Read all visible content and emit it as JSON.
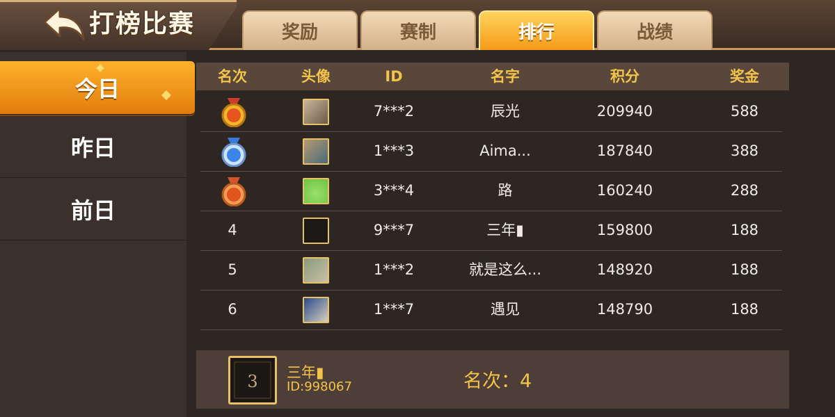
{
  "header": {
    "title": "打榜比赛",
    "tabs": [
      {
        "label": "奖励",
        "active": false
      },
      {
        "label": "赛制",
        "active": false
      },
      {
        "label": "排行",
        "active": true
      },
      {
        "label": "战绩",
        "active": false
      }
    ]
  },
  "sidebar": {
    "items": [
      {
        "label": "今日",
        "active": true
      },
      {
        "label": "昨日",
        "active": false
      },
      {
        "label": "前日",
        "active": false
      }
    ]
  },
  "table": {
    "columns": [
      "名次",
      "头像",
      "ID",
      "名字",
      "积分",
      "奖金"
    ],
    "rows": [
      {
        "rank": "1",
        "medal": "gold-medal-icon",
        "id": "7***2",
        "name": "辰光",
        "score": "209940",
        "bonus": "588"
      },
      {
        "rank": "2",
        "medal": "silver-medal-icon",
        "id": "1***3",
        "name": "Aima...",
        "score": "187840",
        "bonus": "388"
      },
      {
        "rank": "3",
        "medal": "bronze-medal-icon",
        "id": "3***4",
        "name": "路",
        "score": "160240",
        "bonus": "288"
      },
      {
        "rank": "4",
        "medal": "",
        "id": "9***7",
        "name": "三年▮",
        "score": "159800",
        "bonus": "188"
      },
      {
        "rank": "5",
        "medal": "",
        "id": "1***2",
        "name": "就是这么...",
        "score": "148920",
        "bonus": "188"
      },
      {
        "rank": "6",
        "medal": "",
        "id": "1***7",
        "name": "遇见",
        "score": "148790",
        "bonus": "188"
      }
    ]
  },
  "my_rank": {
    "name": "三年▮",
    "id": "ID:998067",
    "rank_label": "名次：",
    "rank_value": "4",
    "avatar_text": "3"
  },
  "colors": {
    "accent_orange": "#f59a1a",
    "gold_text": "#f4c34a",
    "header_text": "#f2c54a"
  }
}
